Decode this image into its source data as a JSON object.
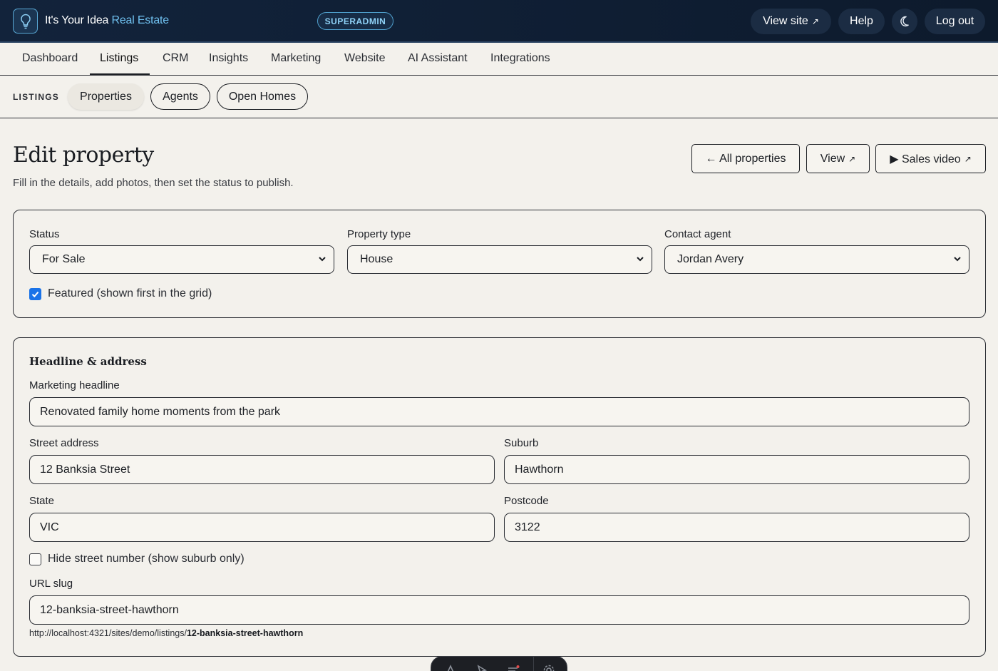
{
  "topbar": {
    "brand_name": "It's Your Idea",
    "brand_accent": "Real Estate",
    "role_badge": "SUPERADMIN",
    "view_site": "View site",
    "help": "Help",
    "theme_icon": "moon-icon",
    "logout": "Log out"
  },
  "nav": {
    "items": [
      "Dashboard",
      "Listings",
      "CRM",
      "Insights",
      "Marketing",
      "Website",
      "AI Assistant",
      "Integrations"
    ],
    "active": "Listings"
  },
  "subnav": {
    "label": "LISTINGS",
    "items": [
      "Properties",
      "Agents",
      "Open Homes"
    ],
    "active": "Properties"
  },
  "header": {
    "title": "Edit property",
    "subtitle": "Fill in the details, add photos, then set the status to publish.",
    "all_properties": "← All properties",
    "view": "View",
    "sales_video": "▶ Sales video"
  },
  "settings": {
    "status_label": "Status",
    "status_value": "For Sale",
    "type_label": "Property type",
    "type_value": "House",
    "agent_label": "Contact agent",
    "agent_value": "Jordan Avery",
    "featured_label": "Featured (shown first in the grid)",
    "featured_checked": true
  },
  "address": {
    "section_title": "Headline & address",
    "headline_label": "Marketing headline",
    "headline_value": "Renovated family home moments from the park",
    "street_label": "Street address",
    "street_value": "12 Banksia Street",
    "suburb_label": "Suburb",
    "suburb_value": "Hawthorn",
    "state_label": "State",
    "state_value": "VIC",
    "postcode_label": "Postcode",
    "postcode_value": "3122",
    "hide_label": "Hide street number (show suburb only)",
    "hide_checked": false,
    "slug_label": "URL slug",
    "slug_value": "12-banksia-street-hawthorn",
    "url_prefix": "http://localhost:4321/sites/demo/listings/",
    "url_slug": "12-banksia-street-hawthorn"
  },
  "colors": {
    "topbar": "#12233b",
    "accent": "#6fc0ef",
    "checkbox": "#1a73e8",
    "background": "#f3f1ec"
  }
}
